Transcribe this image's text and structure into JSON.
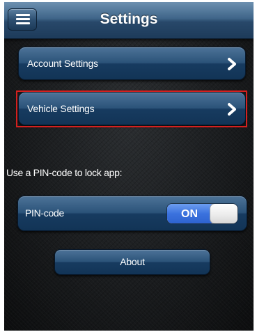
{
  "header": {
    "title": "Settings",
    "menu_icon": "hamburger-menu-icon"
  },
  "rows": {
    "account": {
      "label": "Account Settings",
      "icon": "chevron-right-icon"
    },
    "vehicle": {
      "label": "Vehicle Settings",
      "icon": "chevron-right-icon"
    }
  },
  "pin": {
    "caption": "Use a PIN-code to lock app:",
    "label": "PIN-code",
    "toggle_text": "ON",
    "enabled": true
  },
  "about": {
    "label": "About"
  },
  "colors": {
    "nav_bar": "#3f6589",
    "row_button": "#2b5379",
    "toggle_on": "#3b72de",
    "highlight": "#d4201f",
    "background": "#1a1c1e"
  }
}
